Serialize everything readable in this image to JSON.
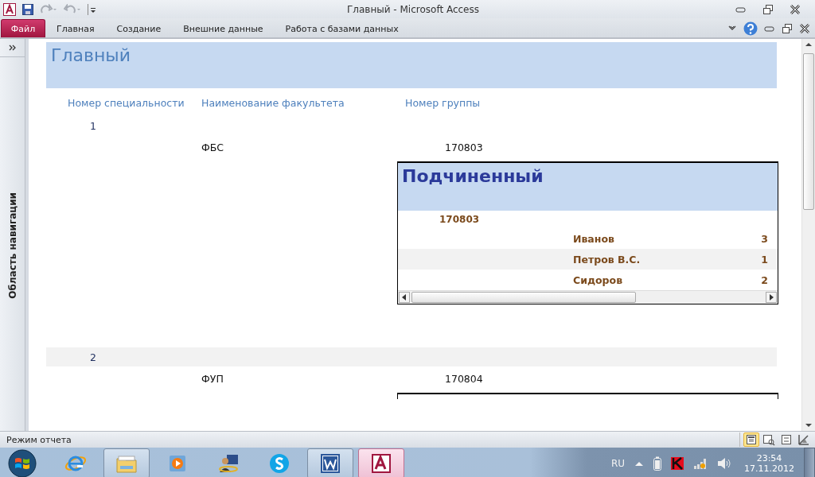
{
  "window": {
    "title": "Главный  -  Microsoft Access"
  },
  "ribbon": {
    "tabs": [
      {
        "label": "Файл",
        "kind": "file"
      },
      {
        "label": "Главная",
        "kind": "tab"
      },
      {
        "label": "Создание",
        "kind": "tab"
      },
      {
        "label": "Внешние данные",
        "kind": "tab"
      },
      {
        "label": "Работа с базами данных",
        "kind": "tab"
      }
    ]
  },
  "navigation_pane": {
    "label": "Область навигации"
  },
  "report": {
    "title": "Главный",
    "columns": [
      "Номер специальности",
      "Наименование факультета",
      "Номер группы"
    ],
    "groups": [
      {
        "specialty": "1",
        "faculty": "ФБС",
        "group": "170803",
        "subform_clipped": false,
        "subform": {
          "title": "Подчиненный",
          "group": "170803",
          "rows": [
            {
              "name": "Иванов",
              "value": "3"
            },
            {
              "name": "Петров В.С.",
              "value": "1"
            },
            {
              "name": "Сидоров",
              "value": "2"
            }
          ]
        }
      },
      {
        "specialty": "2",
        "faculty": "ФУП",
        "group": "170804",
        "subform_clipped": true
      }
    ]
  },
  "status_bar": {
    "text": "Режим отчета",
    "views": [
      {
        "kind": "report",
        "selected": true
      },
      {
        "kind": "preview",
        "selected": false
      },
      {
        "kind": "layout",
        "selected": false
      },
      {
        "kind": "design",
        "selected": false
      }
    ]
  },
  "taskbar": {
    "apps": [
      {
        "kind": "ie",
        "running": false,
        "selected": false
      },
      {
        "kind": "explorer",
        "running": true,
        "selected": false
      },
      {
        "kind": "media",
        "running": false,
        "selected": false
      },
      {
        "kind": "remote",
        "running": false,
        "selected": false
      },
      {
        "kind": "skype",
        "running": false,
        "selected": false
      },
      {
        "kind": "word",
        "running": true,
        "selected": false
      },
      {
        "kind": "access",
        "running": true,
        "selected": true
      }
    ],
    "tray": {
      "language": "RU",
      "time": "23:54",
      "date": "17.11.2012"
    }
  }
}
